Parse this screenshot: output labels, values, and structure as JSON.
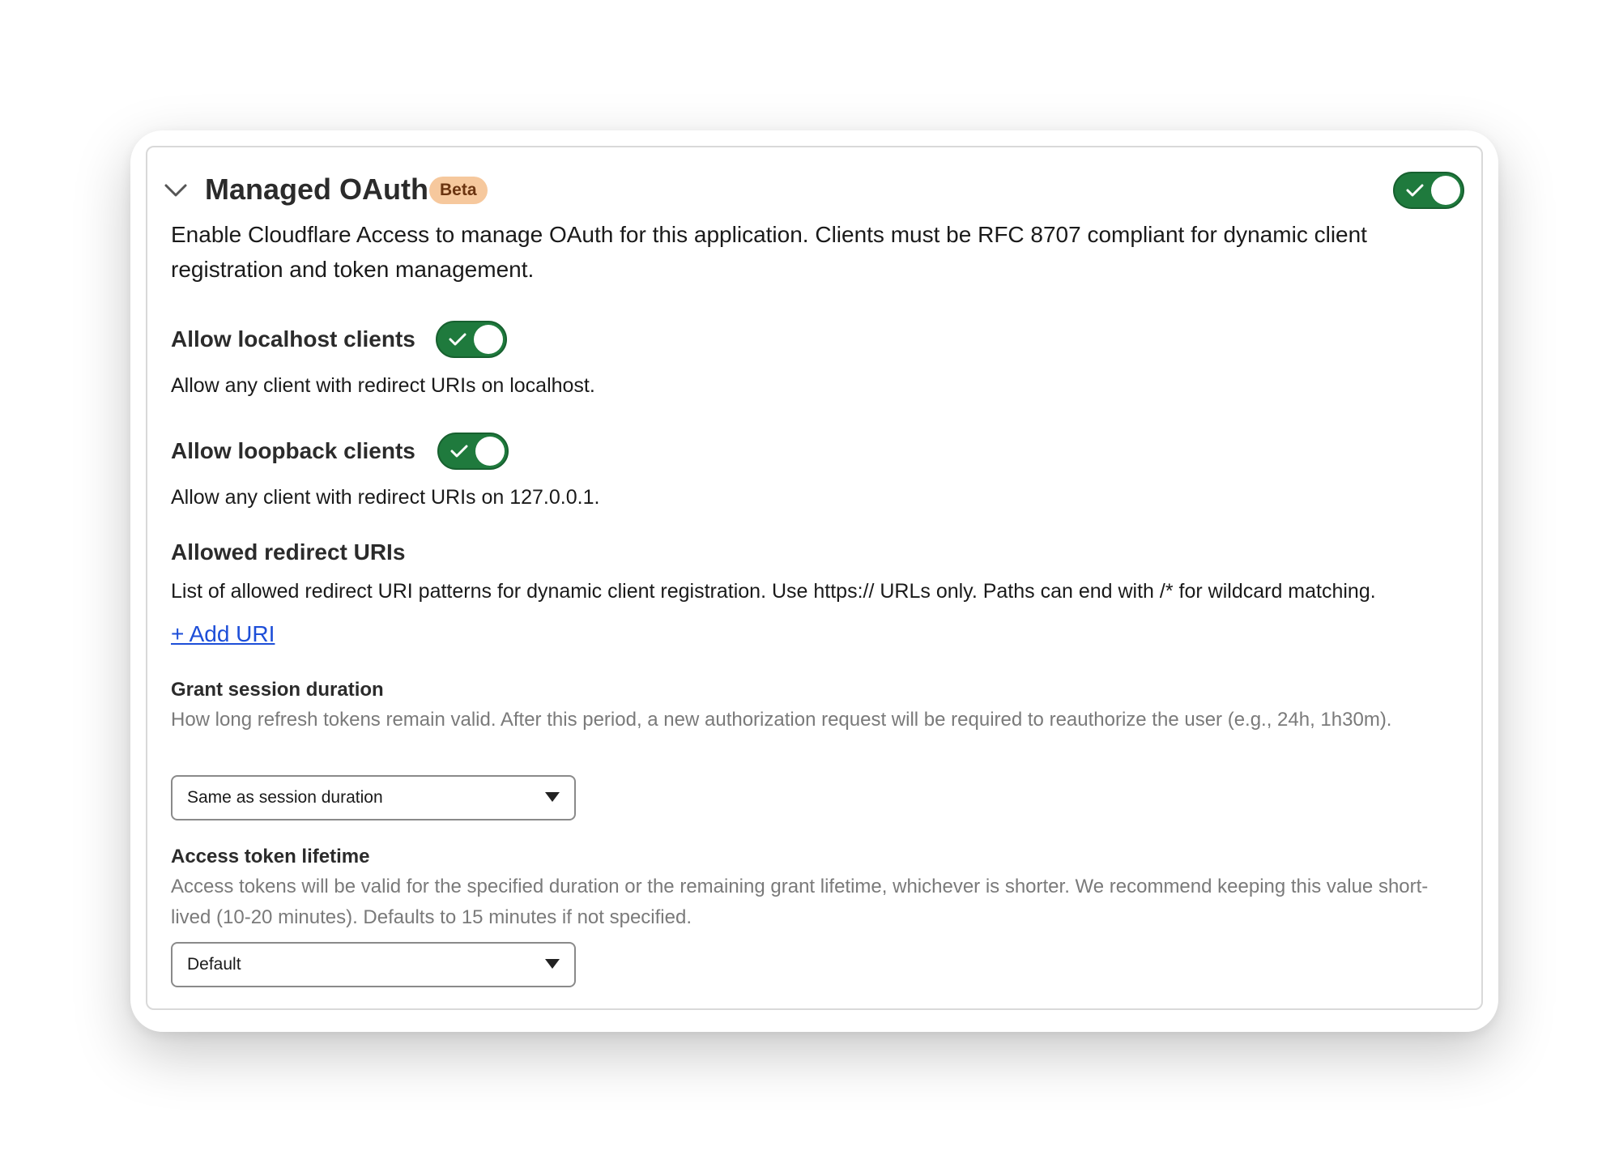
{
  "section": {
    "title": "Managed OAuth",
    "badge": "Beta",
    "enabled": true,
    "description": "Enable Cloudflare Access to manage OAuth for this application. Clients must be RFC 8707 compliant for dynamic client registration and token management."
  },
  "localhost": {
    "label": "Allow localhost clients",
    "enabled": true,
    "description": "Allow any client with redirect URIs on localhost."
  },
  "loopback": {
    "label": "Allow loopback clients",
    "enabled": true,
    "description": "Allow any client with redirect URIs on 127.0.0.1."
  },
  "redirect_uris": {
    "label": "Allowed redirect URIs",
    "description": "List of allowed redirect URI patterns for dynamic client registration. Use https:// URLs only. Paths can end with /* for wildcard matching.",
    "add_link": "+ Add URI"
  },
  "grant_session": {
    "label": "Grant session duration",
    "help": "How long refresh tokens remain valid. After this period, a new authorization request will be required to reauthorize the user (e.g., 24h, 1h30m).",
    "value": "Same as session duration"
  },
  "access_token": {
    "label": "Access token lifetime",
    "help": "Access tokens will be valid for the specified duration or the remaining grant lifetime, whichever is shorter. We recommend keeping this value short-lived (10-20 minutes). Defaults to 15 minutes if not specified.",
    "value": "Default"
  },
  "colors": {
    "toggle_on": "#1f7a3d",
    "badge_bg": "#f6c89d",
    "link": "#1d4ed8"
  },
  "icons": {
    "collapse": "chevron-down-icon",
    "toggle_check": "check-icon",
    "select_caret": "caret-down-icon"
  }
}
